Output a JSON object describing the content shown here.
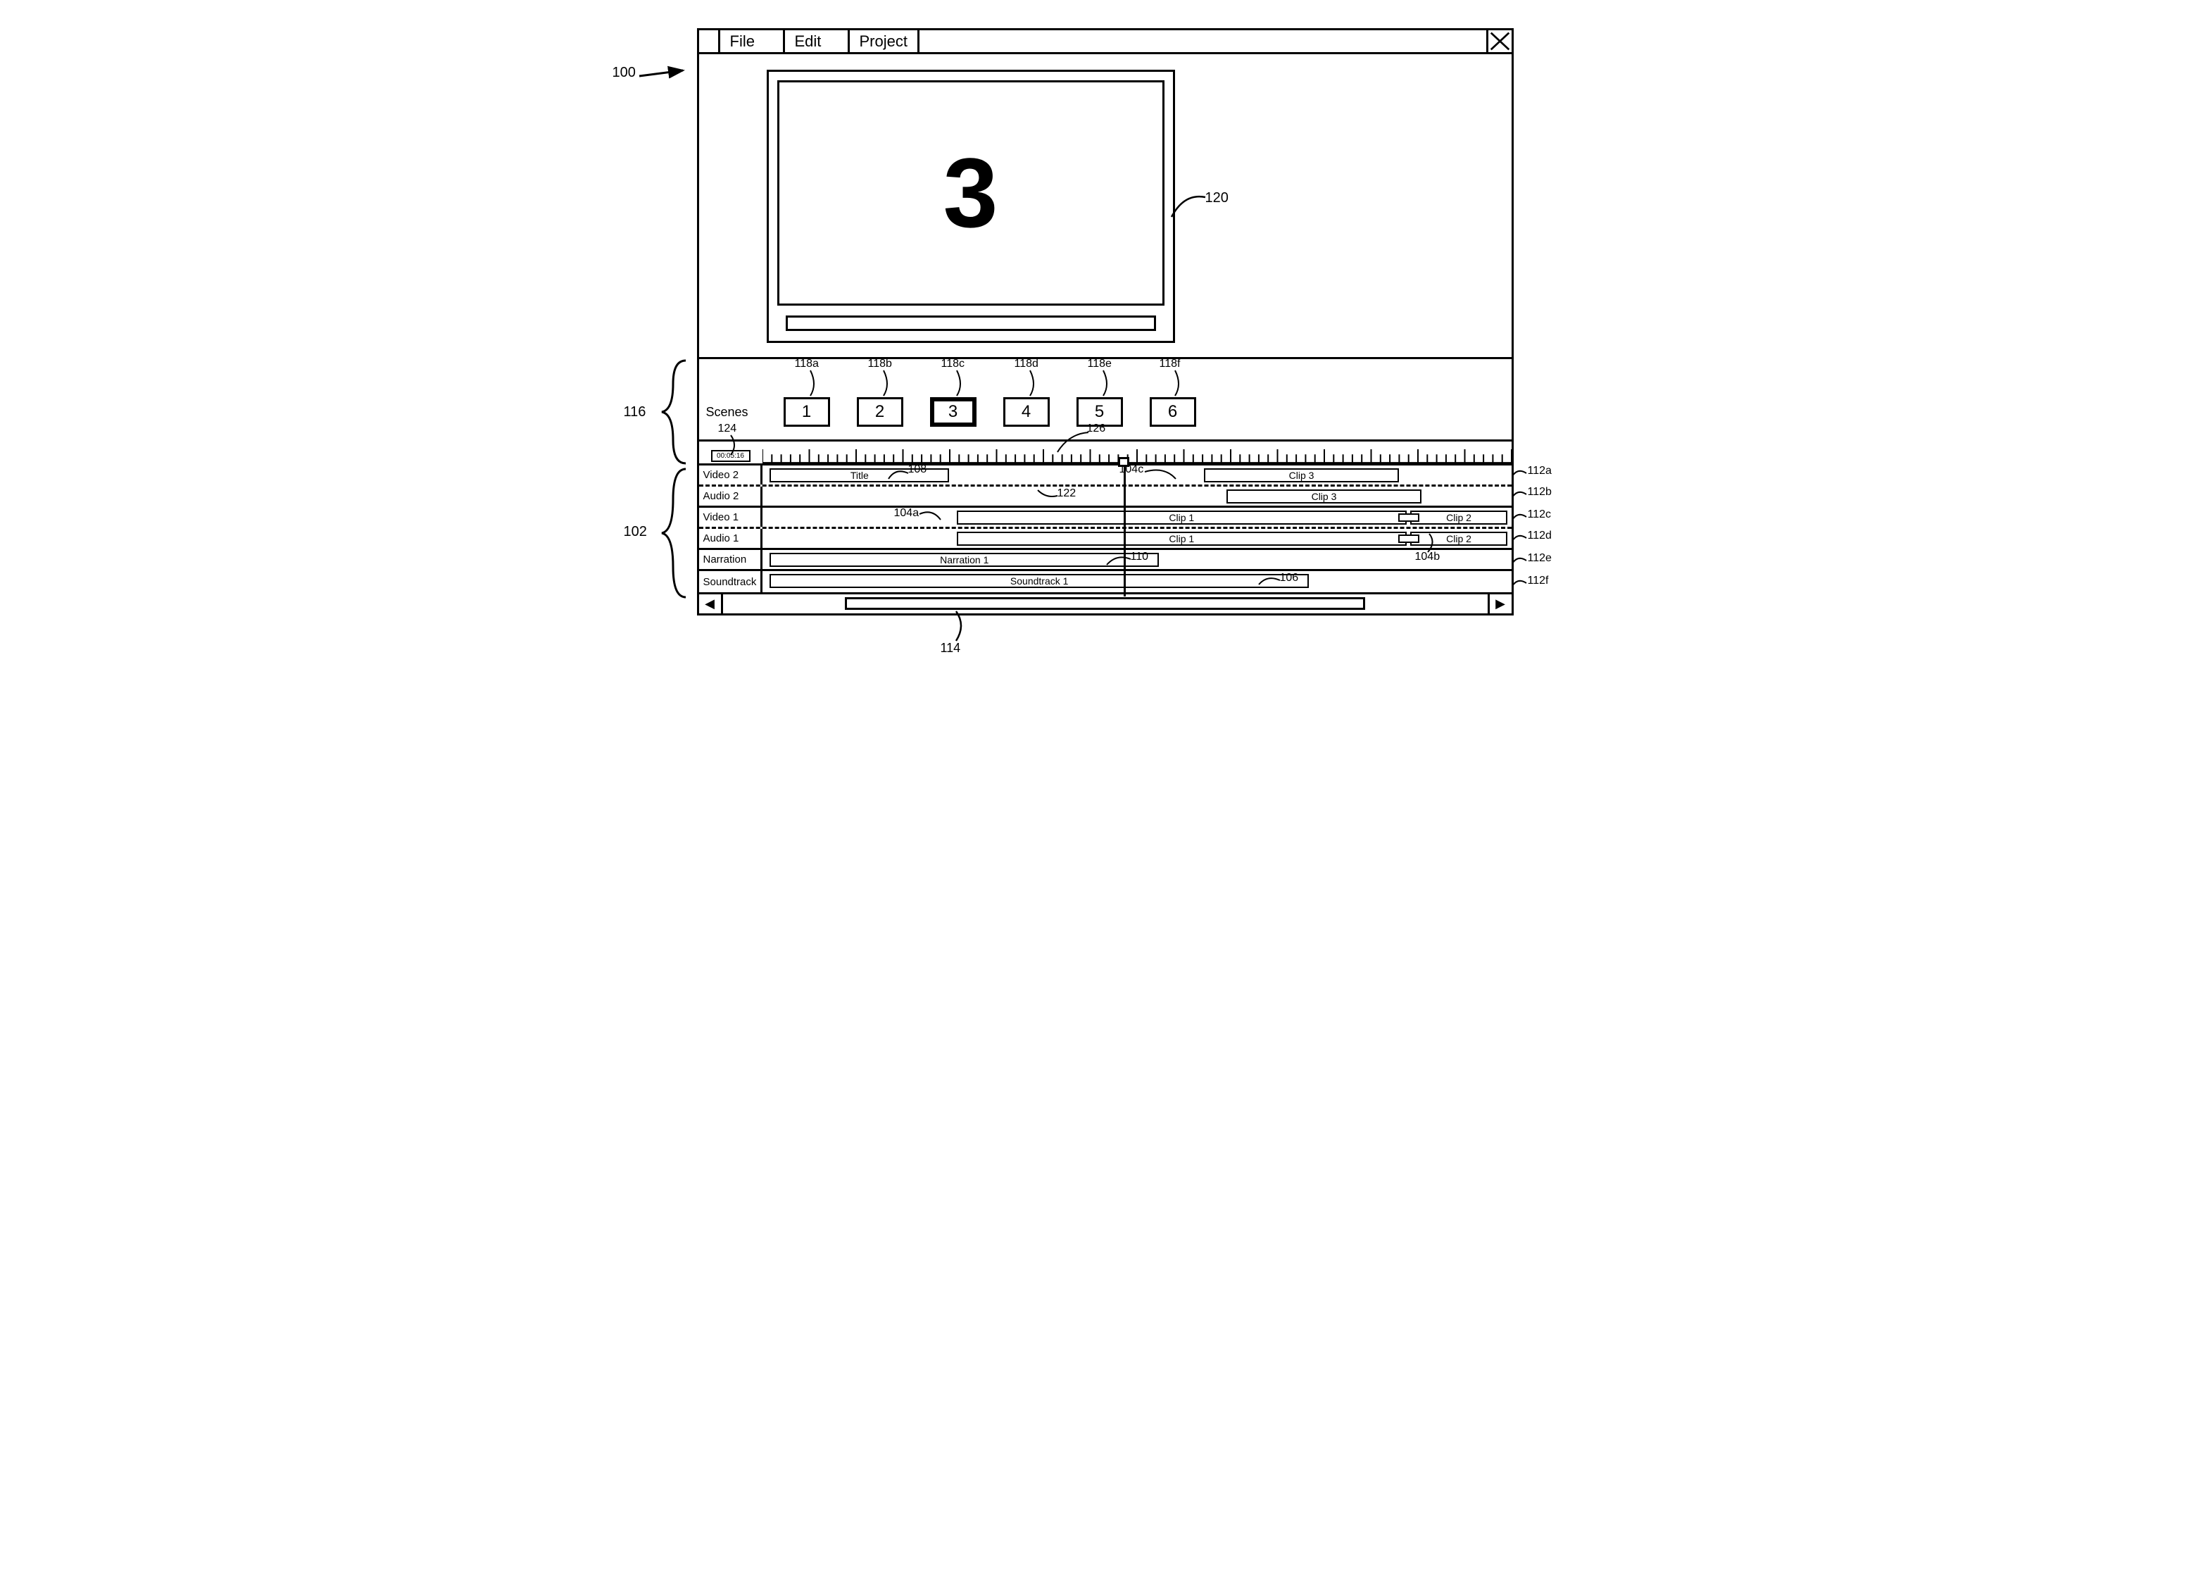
{
  "menu": {
    "items": [
      "File",
      "Edit",
      "Project"
    ]
  },
  "preview": {
    "current_scene_number": "3"
  },
  "scenes": {
    "label": "Scenes",
    "items": [
      {
        "n": "1",
        "ref": "118a"
      },
      {
        "n": "2",
        "ref": "118b"
      },
      {
        "n": "3",
        "ref": "118c",
        "selected": true
      },
      {
        "n": "4",
        "ref": "118d"
      },
      {
        "n": "5",
        "ref": "118e"
      },
      {
        "n": "6",
        "ref": "118f"
      }
    ]
  },
  "timecode": "00:05:16",
  "tracks": {
    "video2": {
      "label": "Video 2"
    },
    "audio2": {
      "label": "Audio 2"
    },
    "video1": {
      "label": "Video 1"
    },
    "audio1": {
      "label": "Audio 1"
    },
    "narration": {
      "label": "Narration"
    },
    "soundtrack": {
      "label": "Soundtrack"
    }
  },
  "clips": {
    "title": "Title",
    "clip3_v": "Clip 3",
    "clip3_a": "Clip 3",
    "clip1_v": "Clip 1",
    "clip2_v": "Clip 2",
    "clip1_a": "Clip 1",
    "clip2_a": "Clip 2",
    "narration1": "Narration 1",
    "soundtrack1": "Soundtrack 1"
  },
  "refs": {
    "r100": "100",
    "r102": "102",
    "r104a": "104a",
    "r104b": "104b",
    "r104c": "104c",
    "r106": "106",
    "r108": "108",
    "r110": "110",
    "r112a": "112a",
    "r112b": "112b",
    "r112c": "112c",
    "r112d": "112d",
    "r112e": "112e",
    "r112f": "112f",
    "r114": "114",
    "r116": "116",
    "r120": "120",
    "r122": "122",
    "r124": "124",
    "r126": "126"
  }
}
